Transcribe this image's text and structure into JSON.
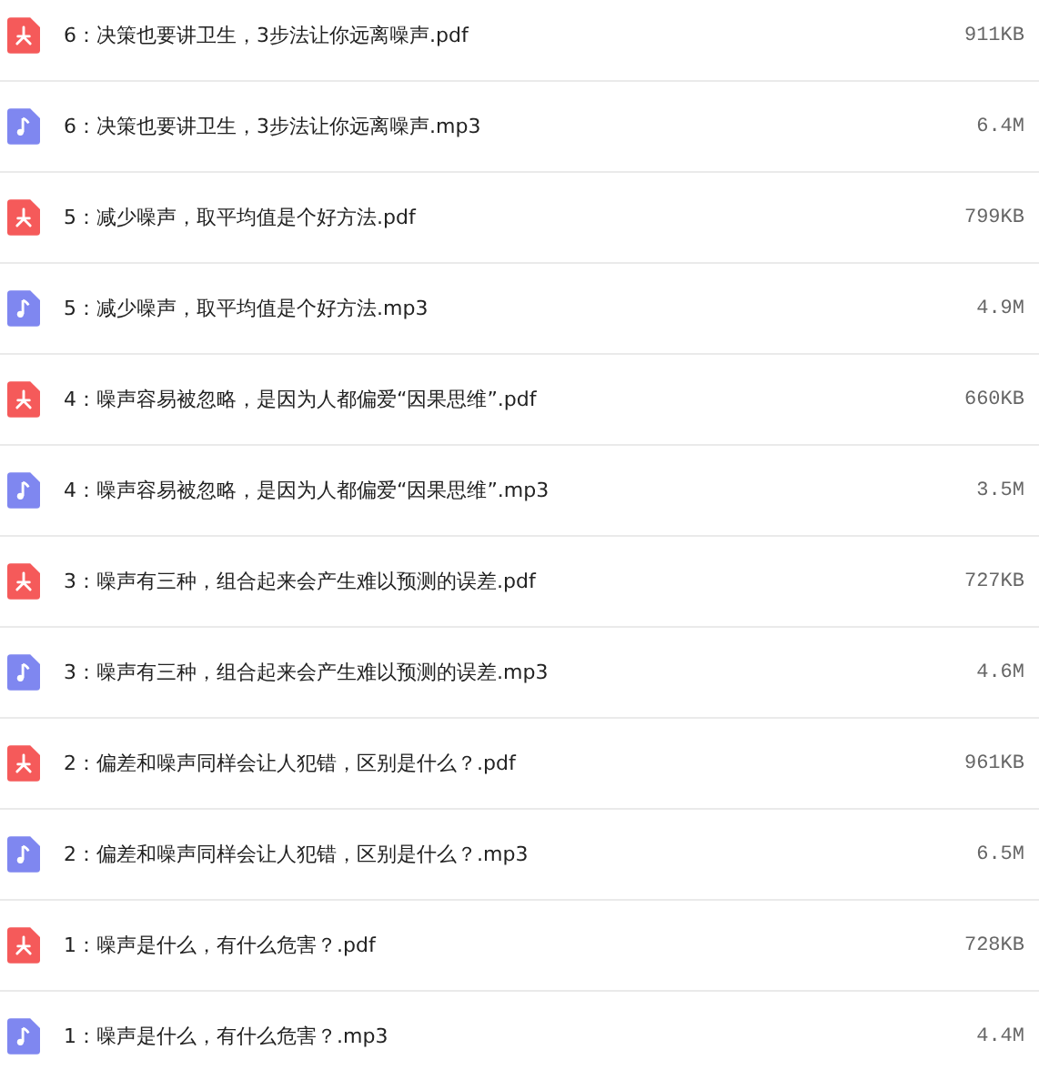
{
  "files": [
    {
      "kind": "pdf",
      "name": "6：决策也要讲卫生，3步法让你远离噪声.pdf",
      "size": "911KB"
    },
    {
      "kind": "audio",
      "name": "6：决策也要讲卫生，3步法让你远离噪声.mp3",
      "size": "6.4M"
    },
    {
      "kind": "pdf",
      "name": "5：减少噪声，取平均值是个好方法.pdf",
      "size": "799KB"
    },
    {
      "kind": "audio",
      "name": "5：减少噪声，取平均值是个好方法.mp3",
      "size": "4.9M"
    },
    {
      "kind": "pdf",
      "name": "4：噪声容易被忽略，是因为人都偏爱“因果思维”.pdf",
      "size": "660KB"
    },
    {
      "kind": "audio",
      "name": "4：噪声容易被忽略，是因为人都偏爱“因果思维”.mp3",
      "size": "3.5M"
    },
    {
      "kind": "pdf",
      "name": "3：噪声有三种，组合起来会产生难以预测的误差.pdf",
      "size": "727KB"
    },
    {
      "kind": "audio",
      "name": "3：噪声有三种，组合起来会产生难以预测的误差.mp3",
      "size": "4.6M"
    },
    {
      "kind": "pdf",
      "name": "2：偏差和噪声同样会让人犯错，区别是什么？.pdf",
      "size": "961KB"
    },
    {
      "kind": "audio",
      "name": "2：偏差和噪声同样会让人犯错，区别是什么？.mp3",
      "size": "6.5M"
    },
    {
      "kind": "pdf",
      "name": "1：噪声是什么，有什么危害？.pdf",
      "size": "728KB"
    },
    {
      "kind": "audio",
      "name": "1：噪声是什么，有什么危害？.mp3",
      "size": "4.4M"
    }
  ]
}
